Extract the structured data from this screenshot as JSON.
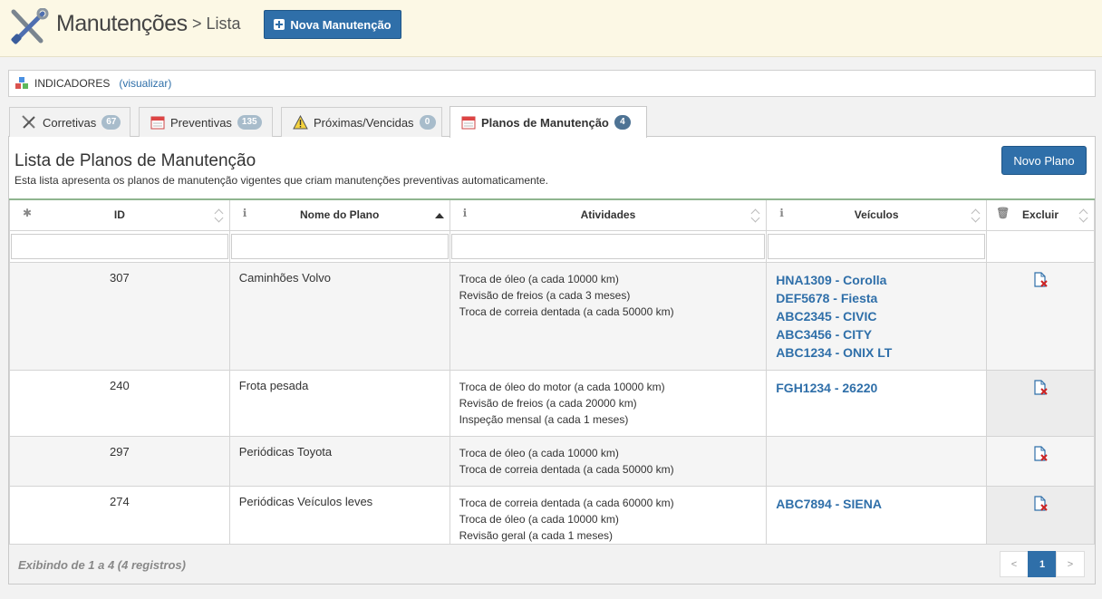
{
  "header": {
    "title": "Manutenções",
    "breadcrumb": "> Lista",
    "new_button": "Nova Manutenção"
  },
  "indicators": {
    "label": "INDICADORES",
    "link": "(visualizar)"
  },
  "tabs": [
    {
      "label": "Corretivas",
      "count": "67",
      "icon": "tools-icon"
    },
    {
      "label": "Preventivas",
      "count": "135",
      "icon": "calendar-icon"
    },
    {
      "label": "Próximas/Vencidas",
      "count": "0",
      "icon": "warning-icon"
    },
    {
      "label": "Planos de Manutenção",
      "count": "4",
      "icon": "calendar-icon"
    }
  ],
  "list": {
    "title": "Lista de Planos de Manutenção",
    "description": "Esta lista apresenta os planos de manutenção vigentes que criam manutenções preventivas automaticamente.",
    "new_plan_button": "Novo Plano"
  },
  "table": {
    "columns": [
      "ID",
      "Nome do Plano",
      "Atividades",
      "Veículos",
      "Excluir"
    ],
    "rows": [
      {
        "id": "307",
        "name": "Caminhões Volvo",
        "activities": [
          "Troca de óleo (a cada 10000 km)",
          "Revisão de freios (a cada 3 meses)",
          "Troca de correia dentada (a cada 50000 km)"
        ],
        "vehicles": [
          "HNA1309 - Corolla",
          "DEF5678 - Fiesta",
          "ABC2345 - CIVIC",
          "ABC3456 - CITY",
          "ABC1234 - ONIX LT"
        ]
      },
      {
        "id": "240",
        "name": "Frota pesada",
        "activities": [
          "Troca de óleo do motor (a cada 10000 km)",
          "Revisão de freios (a cada 20000 km)",
          "Inspeção mensal (a cada 1 meses)"
        ],
        "vehicles": [
          "FGH1234 - 26220"
        ]
      },
      {
        "id": "297",
        "name": "Periódicas Toyota",
        "activities": [
          "Troca de óleo (a cada 10000 km)",
          "Troca de correia dentada (a cada 50000 km)"
        ],
        "vehicles": []
      },
      {
        "id": "274",
        "name": "Periódicas Veículos leves",
        "activities": [
          "Troca de correia dentada (a cada 60000 km)",
          "Troca de óleo (a cada 10000 km)",
          "Revisão geral (a cada 1 meses)"
        ],
        "vehicles": [
          "ABC7894 - SIENA"
        ]
      }
    ]
  },
  "footer": {
    "info": "Exibindo de 1 a 4 (4 registros)",
    "pager": {
      "prev": "<",
      "current": "1",
      "next": ">"
    }
  },
  "colors": {
    "primary": "#2f6fa9",
    "header_bg": "#fcf8e5",
    "badge": "#a8bccb",
    "badge_active": "#4e7394",
    "delete_icon": "#cc2222"
  }
}
